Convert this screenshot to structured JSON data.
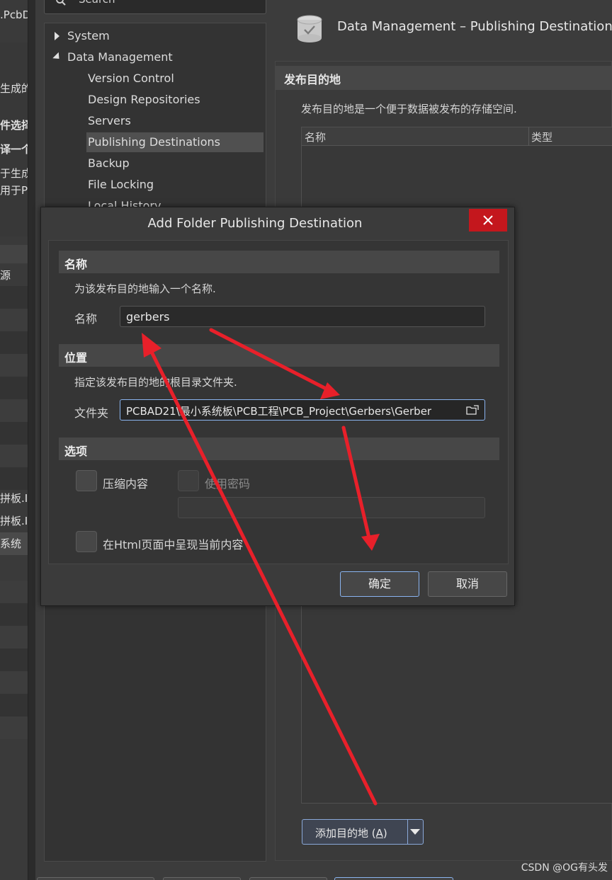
{
  "left_window": {
    "fragments": [
      {
        "text": ".PcbD",
        "bold": false
      },
      {
        "text": "生成的",
        "bold": false
      },
      {
        "text": "件选择",
        "bold": true
      },
      {
        "text": "译一个",
        "bold": true
      },
      {
        "text": "于生成",
        "bold": false
      },
      {
        "text": "用于PC",
        "bold": false
      },
      {
        "text": "源",
        "bold": false
      },
      {
        "text": "拼板.I",
        "bold": false
      },
      {
        "text": "拼板.I",
        "bold": false
      },
      {
        "text": "系统",
        "bold": false
      }
    ]
  },
  "prefs": {
    "search_placeholder": "Search",
    "tree": {
      "system": "System",
      "data_management": "Data Management",
      "version_control": "Version Control",
      "design_repositories": "Design Repositories",
      "servers": "Servers",
      "publishing_destinations": "Publishing Destinations",
      "backup": "Backup",
      "file_locking": "File Locking",
      "local_history": "Local History"
    },
    "header_title": "Data Management – Publishing Destinations",
    "section_title": "发布目的地",
    "section_desc": "发布目的地是一个便于数据被发布的存储空间.",
    "table_columns": [
      "名称",
      "类型"
    ],
    "add_button_label": "添加目的地 (",
    "add_button_accel": "A",
    "add_button_close": ")"
  },
  "dialog": {
    "title": "Add Folder Publishing Destination",
    "name_section": "名称",
    "name_desc": "为该发布目的地输入一个名称.",
    "name_label": "名称",
    "name_value": "gerbers",
    "location_section": "位置",
    "location_desc": "指定该发布目的地的根目录文件夹.",
    "folder_label": "文件夹",
    "folder_value": "PCBAD21\\最小系统板\\PCB工程\\PCB_Project\\Gerbers\\Gerber",
    "options_section": "选项",
    "compress_label": "压缩内容",
    "password_label": "使用密码",
    "html_label": "在Html页面中呈现当前内容",
    "ok_label": "确定",
    "cancel_label": "取消"
  },
  "watermark": "CSDN @OG有头发",
  "colors": {
    "annotation_arrow": "#e8202a",
    "close_button": "#c4171d",
    "focus_border": "#8ab4f0"
  }
}
